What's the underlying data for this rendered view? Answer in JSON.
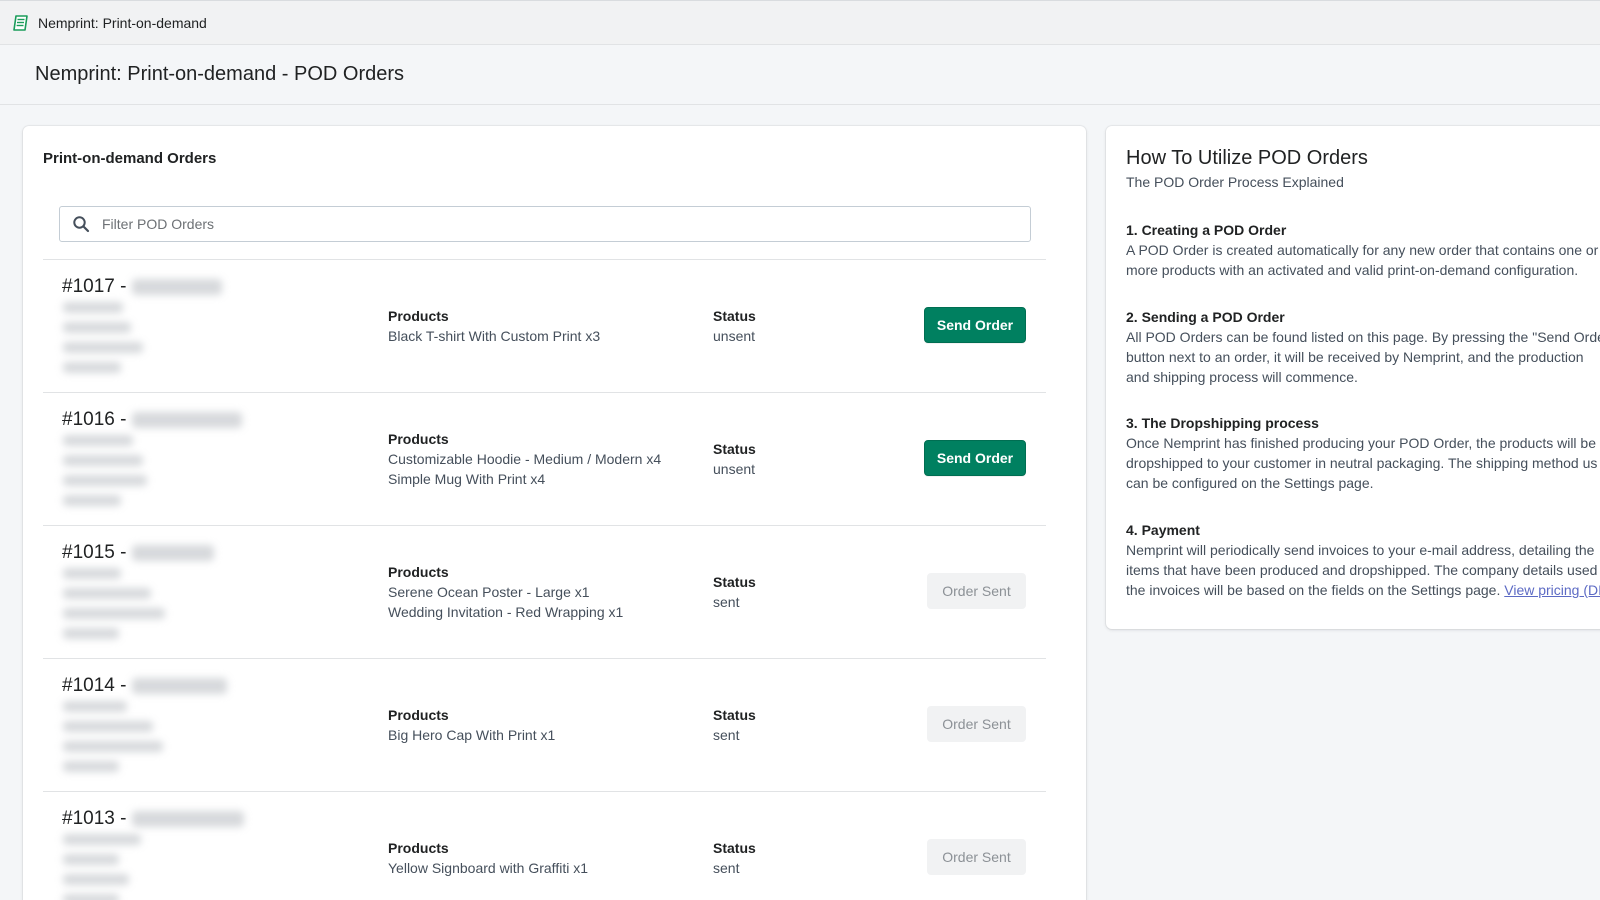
{
  "app": {
    "title": "Nemprint: Print-on-demand",
    "icon": "receipt-icon"
  },
  "page": {
    "title": "Nemprint: Print-on-demand - POD Orders"
  },
  "orders_card": {
    "title": "Print-on-demand Orders",
    "search": {
      "placeholder": "Filter POD Orders",
      "value": ""
    },
    "products_label": "Products",
    "status_label": "Status",
    "orders": [
      {
        "number": "#1017 -",
        "products": [
          "Black T-shirt With Custom Print x3"
        ],
        "status": "unsent",
        "action": "Send Order",
        "enabled": true
      },
      {
        "number": "#1016 -",
        "products": [
          "Customizable Hoodie - Medium / Modern x4",
          "Simple Mug With Print x4"
        ],
        "status": "unsent",
        "action": "Send Order",
        "enabled": true
      },
      {
        "number": "#1015 -",
        "products": [
          "Serene Ocean Poster - Large x1",
          "Wedding Invitation - Red Wrapping x1"
        ],
        "status": "sent",
        "action": "Order Sent",
        "enabled": false
      },
      {
        "number": "#1014 -",
        "products": [
          "Big Hero Cap With Print x1"
        ],
        "status": "sent",
        "action": "Order Sent",
        "enabled": false
      },
      {
        "number": "#1013 -",
        "products": [
          "Yellow Signboard with Graffiti x1"
        ],
        "status": "sent",
        "action": "Order Sent",
        "enabled": false
      }
    ]
  },
  "help_card": {
    "title": "How To Utilize POD Orders",
    "subtitle": "The POD Order Process Explained",
    "sections": [
      {
        "heading": "1. Creating a POD Order",
        "lines": [
          "A POD Order is created automatically for any new order that contains one or",
          "more products with an activated and valid print-on-demand configuration."
        ]
      },
      {
        "heading": "2. Sending a POD Order",
        "lines": [
          "All POD Orders can be found listed on this page. By pressing the \"Send Orde",
          "button next to an order, it will be received by Nemprint, and the production",
          "and shipping process will commence."
        ]
      },
      {
        "heading": "3. The Dropshipping process",
        "lines": [
          "Once Nemprint has finished producing your POD Order, the products will be",
          "dropshipped to your customer in neutral packaging. The shipping method us",
          "can be configured on the Settings page."
        ]
      },
      {
        "heading": "4. Payment",
        "lines": [
          "Nemprint will periodically send invoices to your e-mail address, detailing the",
          "items that have been produced and dropshipped. The company details used",
          "the invoices will be based on the fields on the Settings page."
        ],
        "link": "View pricing (DI"
      }
    ]
  },
  "colors": {
    "primary": "#008060",
    "link": "#5c6ac4",
    "disabled_bg": "#f1f2f3"
  }
}
